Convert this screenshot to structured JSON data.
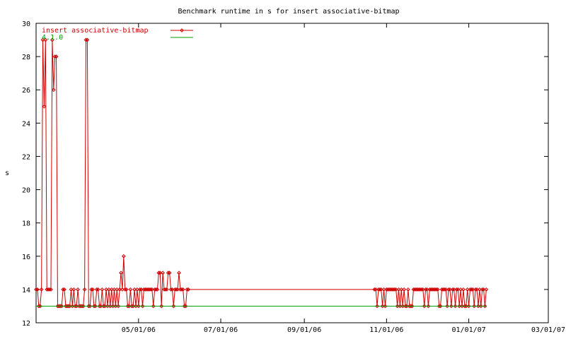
{
  "chart_data": {
    "type": "line",
    "title": "Benchmark runtime in s for insert associative-bitmap",
    "xlabel": "",
    "ylabel": "s",
    "xlim": [
      "2006-02-14",
      "2007-03-01"
    ],
    "ylim": [
      12,
      30
    ],
    "x_ticks": [
      "05/01/06",
      "07/01/06",
      "09/01/06",
      "11/01/06",
      "01/01/07",
      "03/01/07"
    ],
    "y_ticks": [
      12,
      14,
      16,
      18,
      20,
      22,
      24,
      26,
      28,
      30
    ],
    "legend_position": "top-left",
    "grid": false,
    "series": [
      {
        "name": "insert associative-bitmap",
        "color": "#d00000",
        "marker": "diamond",
        "points": [
          [
            "2006-02-14",
            14
          ],
          [
            "2006-02-15",
            14
          ],
          [
            "2006-02-16",
            13
          ],
          [
            "2006-02-17",
            13
          ],
          [
            "2006-02-18",
            14
          ],
          [
            "2006-02-19",
            29
          ],
          [
            "2006-02-20",
            25
          ],
          [
            "2006-02-21",
            29
          ],
          [
            "2006-02-22",
            14
          ],
          [
            "2006-02-23",
            14
          ],
          [
            "2006-02-24",
            14
          ],
          [
            "2006-02-25",
            14
          ],
          [
            "2006-02-26",
            29
          ],
          [
            "2006-02-27",
            26
          ],
          [
            "2006-02-28",
            28
          ],
          [
            "2006-03-01",
            28
          ],
          [
            "2006-03-02",
            13
          ],
          [
            "2006-03-03",
            13
          ],
          [
            "2006-03-04",
            13
          ],
          [
            "2006-03-05",
            13
          ],
          [
            "2006-03-06",
            14
          ],
          [
            "2006-03-07",
            14
          ],
          [
            "2006-03-08",
            13
          ],
          [
            "2006-03-09",
            13
          ],
          [
            "2006-03-10",
            13
          ],
          [
            "2006-03-11",
            13
          ],
          [
            "2006-03-12",
            14
          ],
          [
            "2006-03-13",
            13
          ],
          [
            "2006-03-14",
            14
          ],
          [
            "2006-03-15",
            13
          ],
          [
            "2006-03-16",
            13
          ],
          [
            "2006-03-17",
            14
          ],
          [
            "2006-03-18",
            13
          ],
          [
            "2006-03-19",
            13
          ],
          [
            "2006-03-20",
            13
          ],
          [
            "2006-03-21",
            13
          ],
          [
            "2006-03-22",
            14
          ],
          [
            "2006-03-23",
            29
          ],
          [
            "2006-03-24",
            29
          ],
          [
            "2006-03-25",
            13
          ],
          [
            "2006-03-26",
            13
          ],
          [
            "2006-03-27",
            14
          ],
          [
            "2006-03-28",
            14
          ],
          [
            "2006-03-29",
            13
          ],
          [
            "2006-03-30",
            13
          ],
          [
            "2006-03-31",
            14
          ],
          [
            "2006-04-01",
            14
          ],
          [
            "2006-04-02",
            13
          ],
          [
            "2006-04-03",
            13
          ],
          [
            "2006-04-04",
            14
          ],
          [
            "2006-04-05",
            13
          ],
          [
            "2006-04-06",
            13
          ],
          [
            "2006-04-07",
            14
          ],
          [
            "2006-04-08",
            13
          ],
          [
            "2006-04-09",
            14
          ],
          [
            "2006-04-10",
            13
          ],
          [
            "2006-04-11",
            14
          ],
          [
            "2006-04-12",
            13
          ],
          [
            "2006-04-13",
            14
          ],
          [
            "2006-04-14",
            13
          ],
          [
            "2006-04-15",
            14
          ],
          [
            "2006-04-16",
            13
          ],
          [
            "2006-04-17",
            14
          ],
          [
            "2006-04-18",
            15
          ],
          [
            "2006-04-19",
            14
          ],
          [
            "2006-04-20",
            16
          ],
          [
            "2006-04-21",
            14
          ],
          [
            "2006-04-22",
            14
          ],
          [
            "2006-04-23",
            13
          ],
          [
            "2006-04-24",
            13
          ],
          [
            "2006-04-25",
            14
          ],
          [
            "2006-04-26",
            13
          ],
          [
            "2006-04-27",
            13
          ],
          [
            "2006-04-28",
            14
          ],
          [
            "2006-04-29",
            13
          ],
          [
            "2006-04-30",
            14
          ],
          [
            "2006-05-01",
            13
          ],
          [
            "2006-05-02",
            14
          ],
          [
            "2006-05-03",
            14
          ],
          [
            "2006-05-04",
            13
          ],
          [
            "2006-05-05",
            14
          ],
          [
            "2006-05-06",
            14
          ],
          [
            "2006-05-07",
            14
          ],
          [
            "2006-05-08",
            14
          ],
          [
            "2006-05-09",
            14
          ],
          [
            "2006-05-10",
            14
          ],
          [
            "2006-05-11",
            14
          ],
          [
            "2006-05-12",
            13
          ],
          [
            "2006-05-13",
            14
          ],
          [
            "2006-05-14",
            14
          ],
          [
            "2006-05-15",
            14
          ],
          [
            "2006-05-16",
            15
          ],
          [
            "2006-05-17",
            15
          ],
          [
            "2006-05-18",
            13
          ],
          [
            "2006-05-19",
            15
          ],
          [
            "2006-05-20",
            14
          ],
          [
            "2006-05-21",
            14
          ],
          [
            "2006-05-22",
            14
          ],
          [
            "2006-05-23",
            15
          ],
          [
            "2006-05-24",
            15
          ],
          [
            "2006-05-25",
            14
          ],
          [
            "2006-05-26",
            14
          ],
          [
            "2006-05-27",
            13
          ],
          [
            "2006-05-28",
            14
          ],
          [
            "2006-05-29",
            14
          ],
          [
            "2006-05-30",
            14
          ],
          [
            "2006-05-31",
            15
          ],
          [
            "2006-06-01",
            14
          ],
          [
            "2006-06-02",
            14
          ],
          [
            "2006-06-03",
            14
          ],
          [
            "2006-06-04",
            13
          ],
          [
            "2006-06-05",
            13
          ],
          [
            "2006-06-06",
            14
          ],
          [
            "2006-06-07",
            14
          ],
          [
            "2006-10-23",
            14
          ],
          [
            "2006-10-24",
            14
          ],
          [
            "2006-10-25",
            13
          ],
          [
            "2006-10-26",
            14
          ],
          [
            "2006-10-27",
            14
          ],
          [
            "2006-10-28",
            14
          ],
          [
            "2006-10-29",
            13
          ],
          [
            "2006-10-30",
            14
          ],
          [
            "2006-10-31",
            13
          ],
          [
            "2006-11-01",
            14
          ],
          [
            "2006-11-02",
            14
          ],
          [
            "2006-11-03",
            14
          ],
          [
            "2006-11-04",
            14
          ],
          [
            "2006-11-05",
            14
          ],
          [
            "2006-11-06",
            14
          ],
          [
            "2006-11-07",
            14
          ],
          [
            "2006-11-08",
            14
          ],
          [
            "2006-11-09",
            13
          ],
          [
            "2006-11-10",
            14
          ],
          [
            "2006-11-11",
            13
          ],
          [
            "2006-11-12",
            14
          ],
          [
            "2006-11-13",
            13
          ],
          [
            "2006-11-14",
            14
          ],
          [
            "2006-11-15",
            13
          ],
          [
            "2006-11-16",
            13
          ],
          [
            "2006-11-17",
            14
          ],
          [
            "2006-11-18",
            13
          ],
          [
            "2006-11-19",
            13
          ],
          [
            "2006-11-20",
            13
          ],
          [
            "2006-11-21",
            14
          ],
          [
            "2006-11-22",
            14
          ],
          [
            "2006-11-23",
            14
          ],
          [
            "2006-11-24",
            14
          ],
          [
            "2006-11-25",
            14
          ],
          [
            "2006-11-26",
            14
          ],
          [
            "2006-11-27",
            14
          ],
          [
            "2006-11-28",
            14
          ],
          [
            "2006-11-29",
            13
          ],
          [
            "2006-11-30",
            14
          ],
          [
            "2006-12-01",
            14
          ],
          [
            "2006-12-02",
            13
          ],
          [
            "2006-12-03",
            14
          ],
          [
            "2006-12-04",
            14
          ],
          [
            "2006-12-05",
            14
          ],
          [
            "2006-12-06",
            14
          ],
          [
            "2006-12-07",
            14
          ],
          [
            "2006-12-08",
            14
          ],
          [
            "2006-12-09",
            14
          ],
          [
            "2006-12-10",
            13
          ],
          [
            "2006-12-11",
            13
          ],
          [
            "2006-12-12",
            14
          ],
          [
            "2006-12-13",
            14
          ],
          [
            "2006-12-14",
            14
          ],
          [
            "2006-12-15",
            14
          ],
          [
            "2006-12-16",
            13
          ],
          [
            "2006-12-17",
            14
          ],
          [
            "2006-12-18",
            14
          ],
          [
            "2006-12-19",
            13
          ],
          [
            "2006-12-20",
            14
          ],
          [
            "2006-12-21",
            14
          ],
          [
            "2006-12-22",
            13
          ],
          [
            "2006-12-23",
            14
          ],
          [
            "2006-12-24",
            14
          ],
          [
            "2006-12-25",
            13
          ],
          [
            "2006-12-26",
            14
          ],
          [
            "2006-12-27",
            13
          ],
          [
            "2006-12-28",
            14
          ],
          [
            "2006-12-29",
            13
          ],
          [
            "2006-12-30",
            13
          ],
          [
            "2006-12-31",
            14
          ],
          [
            "2007-01-01",
            13
          ],
          [
            "2007-01-02",
            14
          ],
          [
            "2007-01-03",
            14
          ],
          [
            "2007-01-04",
            14
          ],
          [
            "2007-01-05",
            13
          ],
          [
            "2007-01-06",
            14
          ],
          [
            "2007-01-07",
            14
          ],
          [
            "2007-01-08",
            13
          ],
          [
            "2007-01-09",
            14
          ],
          [
            "2007-01-10",
            13
          ],
          [
            "2007-01-11",
            14
          ],
          [
            "2007-01-12",
            14
          ],
          [
            "2007-01-13",
            13
          ],
          [
            "2007-01-14",
            14
          ]
        ]
      },
      {
        "name": "4.1.0",
        "color": "#00a000",
        "marker": "none",
        "points": [
          [
            "2006-02-14",
            13
          ],
          [
            "2007-01-14",
            13
          ]
        ]
      }
    ]
  }
}
